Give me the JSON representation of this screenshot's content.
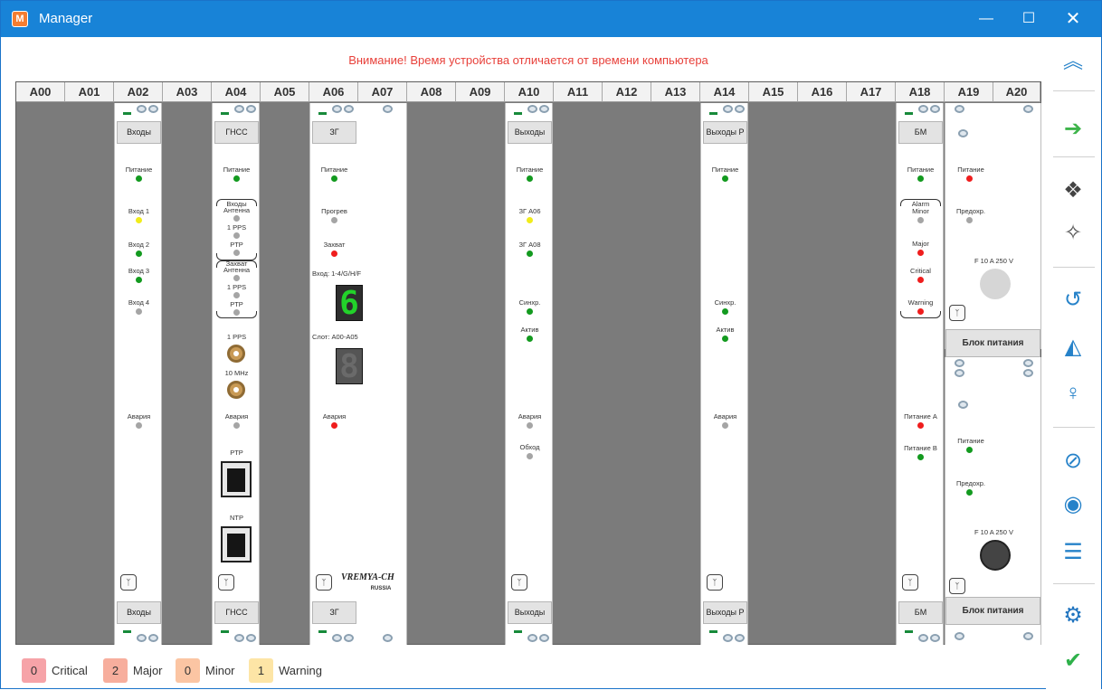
{
  "window": {
    "title": "Manager",
    "app_icon": "manager-logo"
  },
  "warning": "Внимание! Время устройства отличается от времени компьютера",
  "slots": [
    "A00",
    "A01",
    "A02",
    "A03",
    "A04",
    "A05",
    "A06",
    "A07",
    "A08",
    "A09",
    "A10",
    "A11",
    "A12",
    "A13",
    "A14",
    "A15",
    "A16",
    "A17",
    "A18",
    "A19",
    "A20"
  ],
  "modules": {
    "a02": {
      "top_button": "Входы",
      "bottom_button": "Входы",
      "indicators": [
        {
          "label": "Питание",
          "state": "green"
        },
        {
          "label": "Вход 1",
          "state": "yellow"
        },
        {
          "label": "Вход 2",
          "state": "green"
        },
        {
          "label": "Вход 3",
          "state": "green"
        },
        {
          "label": "Вход 4",
          "state": "grey"
        },
        {
          "label": "Авария",
          "state": "grey"
        }
      ]
    },
    "a04": {
      "top_button": "ГНСС",
      "bottom_button": "ГНСС",
      "power": "Питание",
      "group1_title": "Входы",
      "group2_title": "Захват",
      "antenna": "Антенна",
      "pps": "1 PPS",
      "ptp": "PTP",
      "conn_pps": "1 PPS",
      "conn_10mhz": "10 MHz",
      "alarm": "Авария",
      "port_ptp": "PTP",
      "port_ntp": "NTP"
    },
    "a06": {
      "top_button": "ЗГ",
      "bottom_button": "ЗГ",
      "power": "Питание",
      "warmup": "Прогрев",
      "capture": "Захват",
      "input_label": "Вход: 1-4/G/H/F",
      "input_digit": "6",
      "slot_label": "Слот: A00-A05",
      "slot_digit": "8",
      "alarm": "Авария",
      "brand": "VREMYA-CH",
      "brand_sub": "RUSSIA"
    },
    "a10": {
      "top_button": "Выходы",
      "bottom_button": "Выходы",
      "power": "Питание",
      "zg06": "ЗГ А06",
      "zg08": "ЗГ А08",
      "sync": "Синхр.",
      "active": "Актив",
      "alarm": "Авария",
      "bypass": "Обход"
    },
    "a14": {
      "top_button": "Выходы Р",
      "bottom_button": "Выходы Р",
      "power": "Питание",
      "sync": "Синхр.",
      "active": "Актив",
      "alarm": "Авария"
    },
    "a18": {
      "top_button": "БМ",
      "bottom_button": "БМ",
      "power": "Питание",
      "alarm_label": "Alarm",
      "minor": "Minor",
      "major": "Major",
      "critical": "Critical",
      "warning": "Warning",
      "power_a": "Питание А",
      "power_b": "Питание В"
    },
    "psu_top": {
      "power": "Питание",
      "fuse_state": "Предохр.",
      "fuse_rating": "F 10 A 250 V",
      "button": "Блок питания"
    },
    "psu_bottom": {
      "power": "Питание",
      "fuse_state": "Предохр.",
      "fuse_rating": "F 10 A 250 V",
      "button": "Блок питания"
    }
  },
  "legend": [
    {
      "count": "0",
      "label": "Critical",
      "color": "#f6a3a8"
    },
    {
      "count": "2",
      "label": "Major",
      "color": "#f7ae9d"
    },
    {
      "count": "0",
      "label": "Minor",
      "color": "#fbc5a3"
    },
    {
      "count": "1",
      "label": "Warning",
      "color": "#fde5a6"
    }
  ],
  "toolbar": [
    "collapse-up-icon",
    "exit-icon",
    "modules-icon",
    "magic-wand-icon",
    "history-icon",
    "chart-icon",
    "person-icon",
    "block-icon",
    "user-icon",
    "sliders-icon",
    "settings-icon",
    "ok-icon"
  ]
}
